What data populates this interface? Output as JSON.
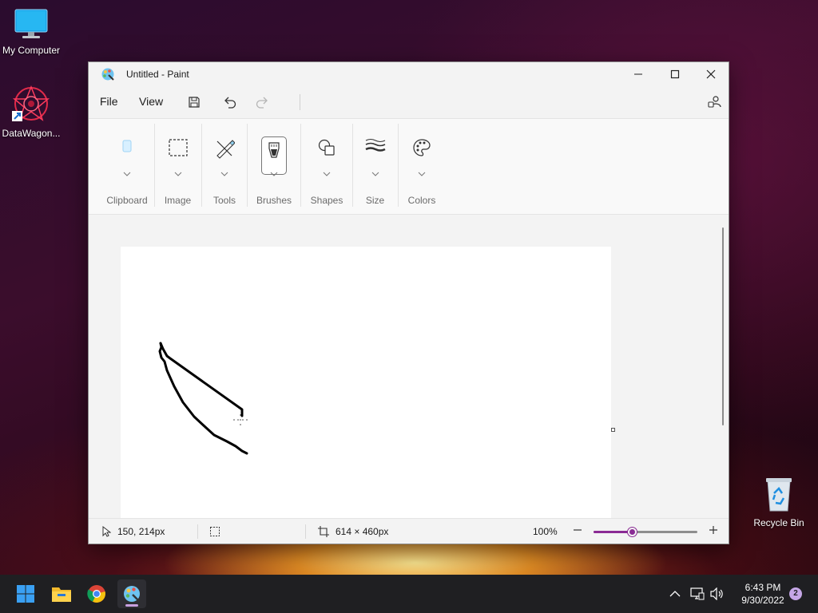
{
  "desktop": {
    "icons": [
      {
        "label": "My Computer"
      },
      {
        "label": "DataWagon..."
      },
      {
        "label": "Recycle Bin"
      }
    ]
  },
  "window": {
    "title": "Untitled - Paint",
    "menu": {
      "file": "File",
      "view": "View"
    },
    "ribbon": {
      "groups": [
        "Clipboard",
        "Image",
        "Tools",
        "Brushes",
        "Shapes",
        "Size",
        "Colors"
      ]
    },
    "status": {
      "cursor_position": "150, 214px",
      "canvas_size": "614 × 460px",
      "zoom": "100%",
      "zoom_level_fraction": 0.37
    }
  },
  "taskbar": {
    "time": "6:43 PM",
    "date": "9/30/2022",
    "notification_count": "2"
  },
  "colors": {
    "accent": "#8a2a94",
    "stroke": "#000000"
  }
}
